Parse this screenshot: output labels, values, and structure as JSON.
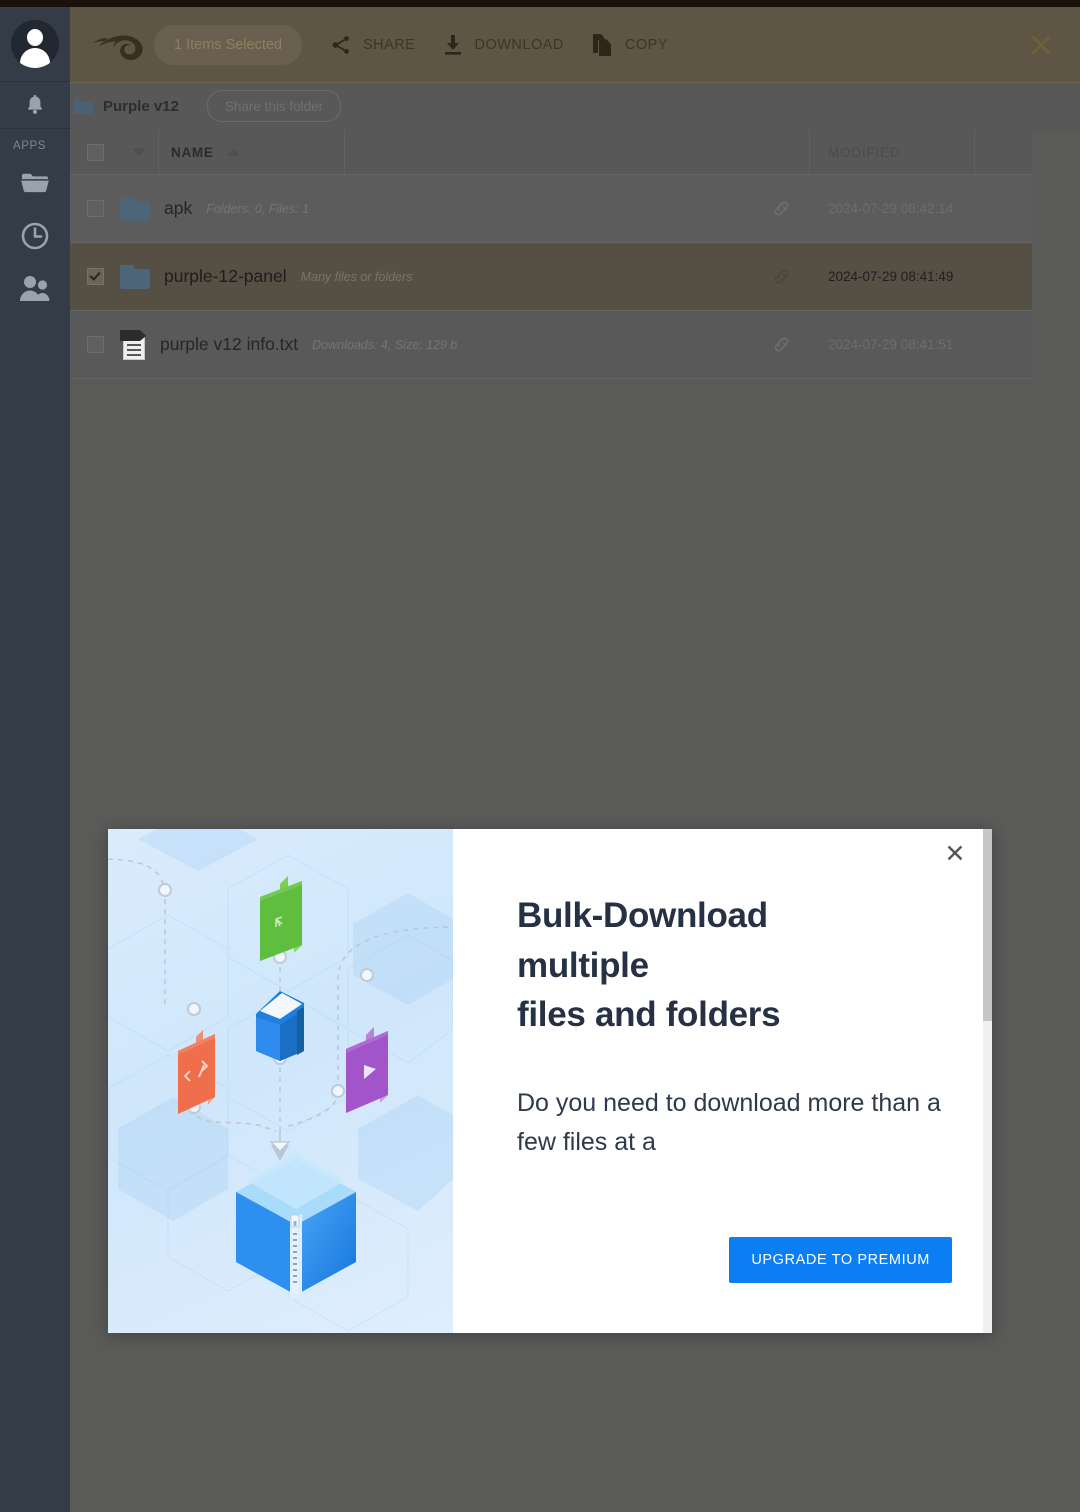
{
  "sidebar": {
    "apps_label": "APPS",
    "items": [
      {
        "name": "avatar",
        "icon": "user-avatar-icon"
      },
      {
        "name": "notifications",
        "icon": "bell-icon"
      },
      {
        "name": "files",
        "icon": "folder-icon"
      },
      {
        "name": "recent",
        "icon": "clock-icon"
      },
      {
        "name": "shared",
        "icon": "people-icon"
      }
    ]
  },
  "toolbar": {
    "logo_icon": "mediafire-flame-icon",
    "selection_label": "1 Items Selected",
    "actions": [
      {
        "label": "SHARE",
        "icon": "share-icon"
      },
      {
        "label": "DOWNLOAD",
        "icon": "download-icon"
      },
      {
        "label": "COPY",
        "icon": "copy-icon"
      }
    ],
    "close_icon": "close-icon"
  },
  "breadcrumb": {
    "folder_icon": "folder-icon",
    "folder_name": "Purple v12",
    "share_button": "Share this folder"
  },
  "table": {
    "headers": {
      "name": "NAME",
      "modified": "MODIFIED"
    },
    "sort_indicator": "ascending-caret-icon",
    "bulk_caret_icon": "chevron-down-icon",
    "rows": [
      {
        "checked": false,
        "type": "folder",
        "icon": "folder-icon",
        "name": "apk",
        "meta": "Folders: 0, Files: 1",
        "link_icon": "link-icon",
        "modified": "2024-07-29 08:42:14",
        "selected": false
      },
      {
        "checked": true,
        "type": "folder",
        "icon": "folder-icon",
        "name": "purple-12-panel",
        "meta": "Many files or folders",
        "link_icon": "link-icon",
        "modified": "2024-07-29 08:41:49",
        "selected": true
      },
      {
        "checked": false,
        "type": "file",
        "icon": "text-document-icon",
        "name": "purple v12 info.txt",
        "meta": "Downloads: 4, Size: 129 b",
        "link_icon": "link-icon",
        "modified": "2024-07-29 08:41:51",
        "selected": false
      }
    ]
  },
  "modal": {
    "close_icon": "close-icon",
    "illustration": "bulk-download-isometric-illustration",
    "title": "Bulk-Download multiple\nfiles and folders",
    "title_line1": "Bulk-Download",
    "title_line2": "multiple",
    "title_line3": "files and folders",
    "paragraph": "Do you need to download more than a few files at a",
    "cta_label": "UPGRADE TO PREMIUM"
  },
  "colors": {
    "page_overlay": "#5a5a59",
    "toolbar_amber": "#5e5544",
    "sidebar_dark": "#343c48",
    "selected_row": "#565044",
    "cta_blue": "#0b7ef4",
    "folder_blue": "#4c6578"
  }
}
